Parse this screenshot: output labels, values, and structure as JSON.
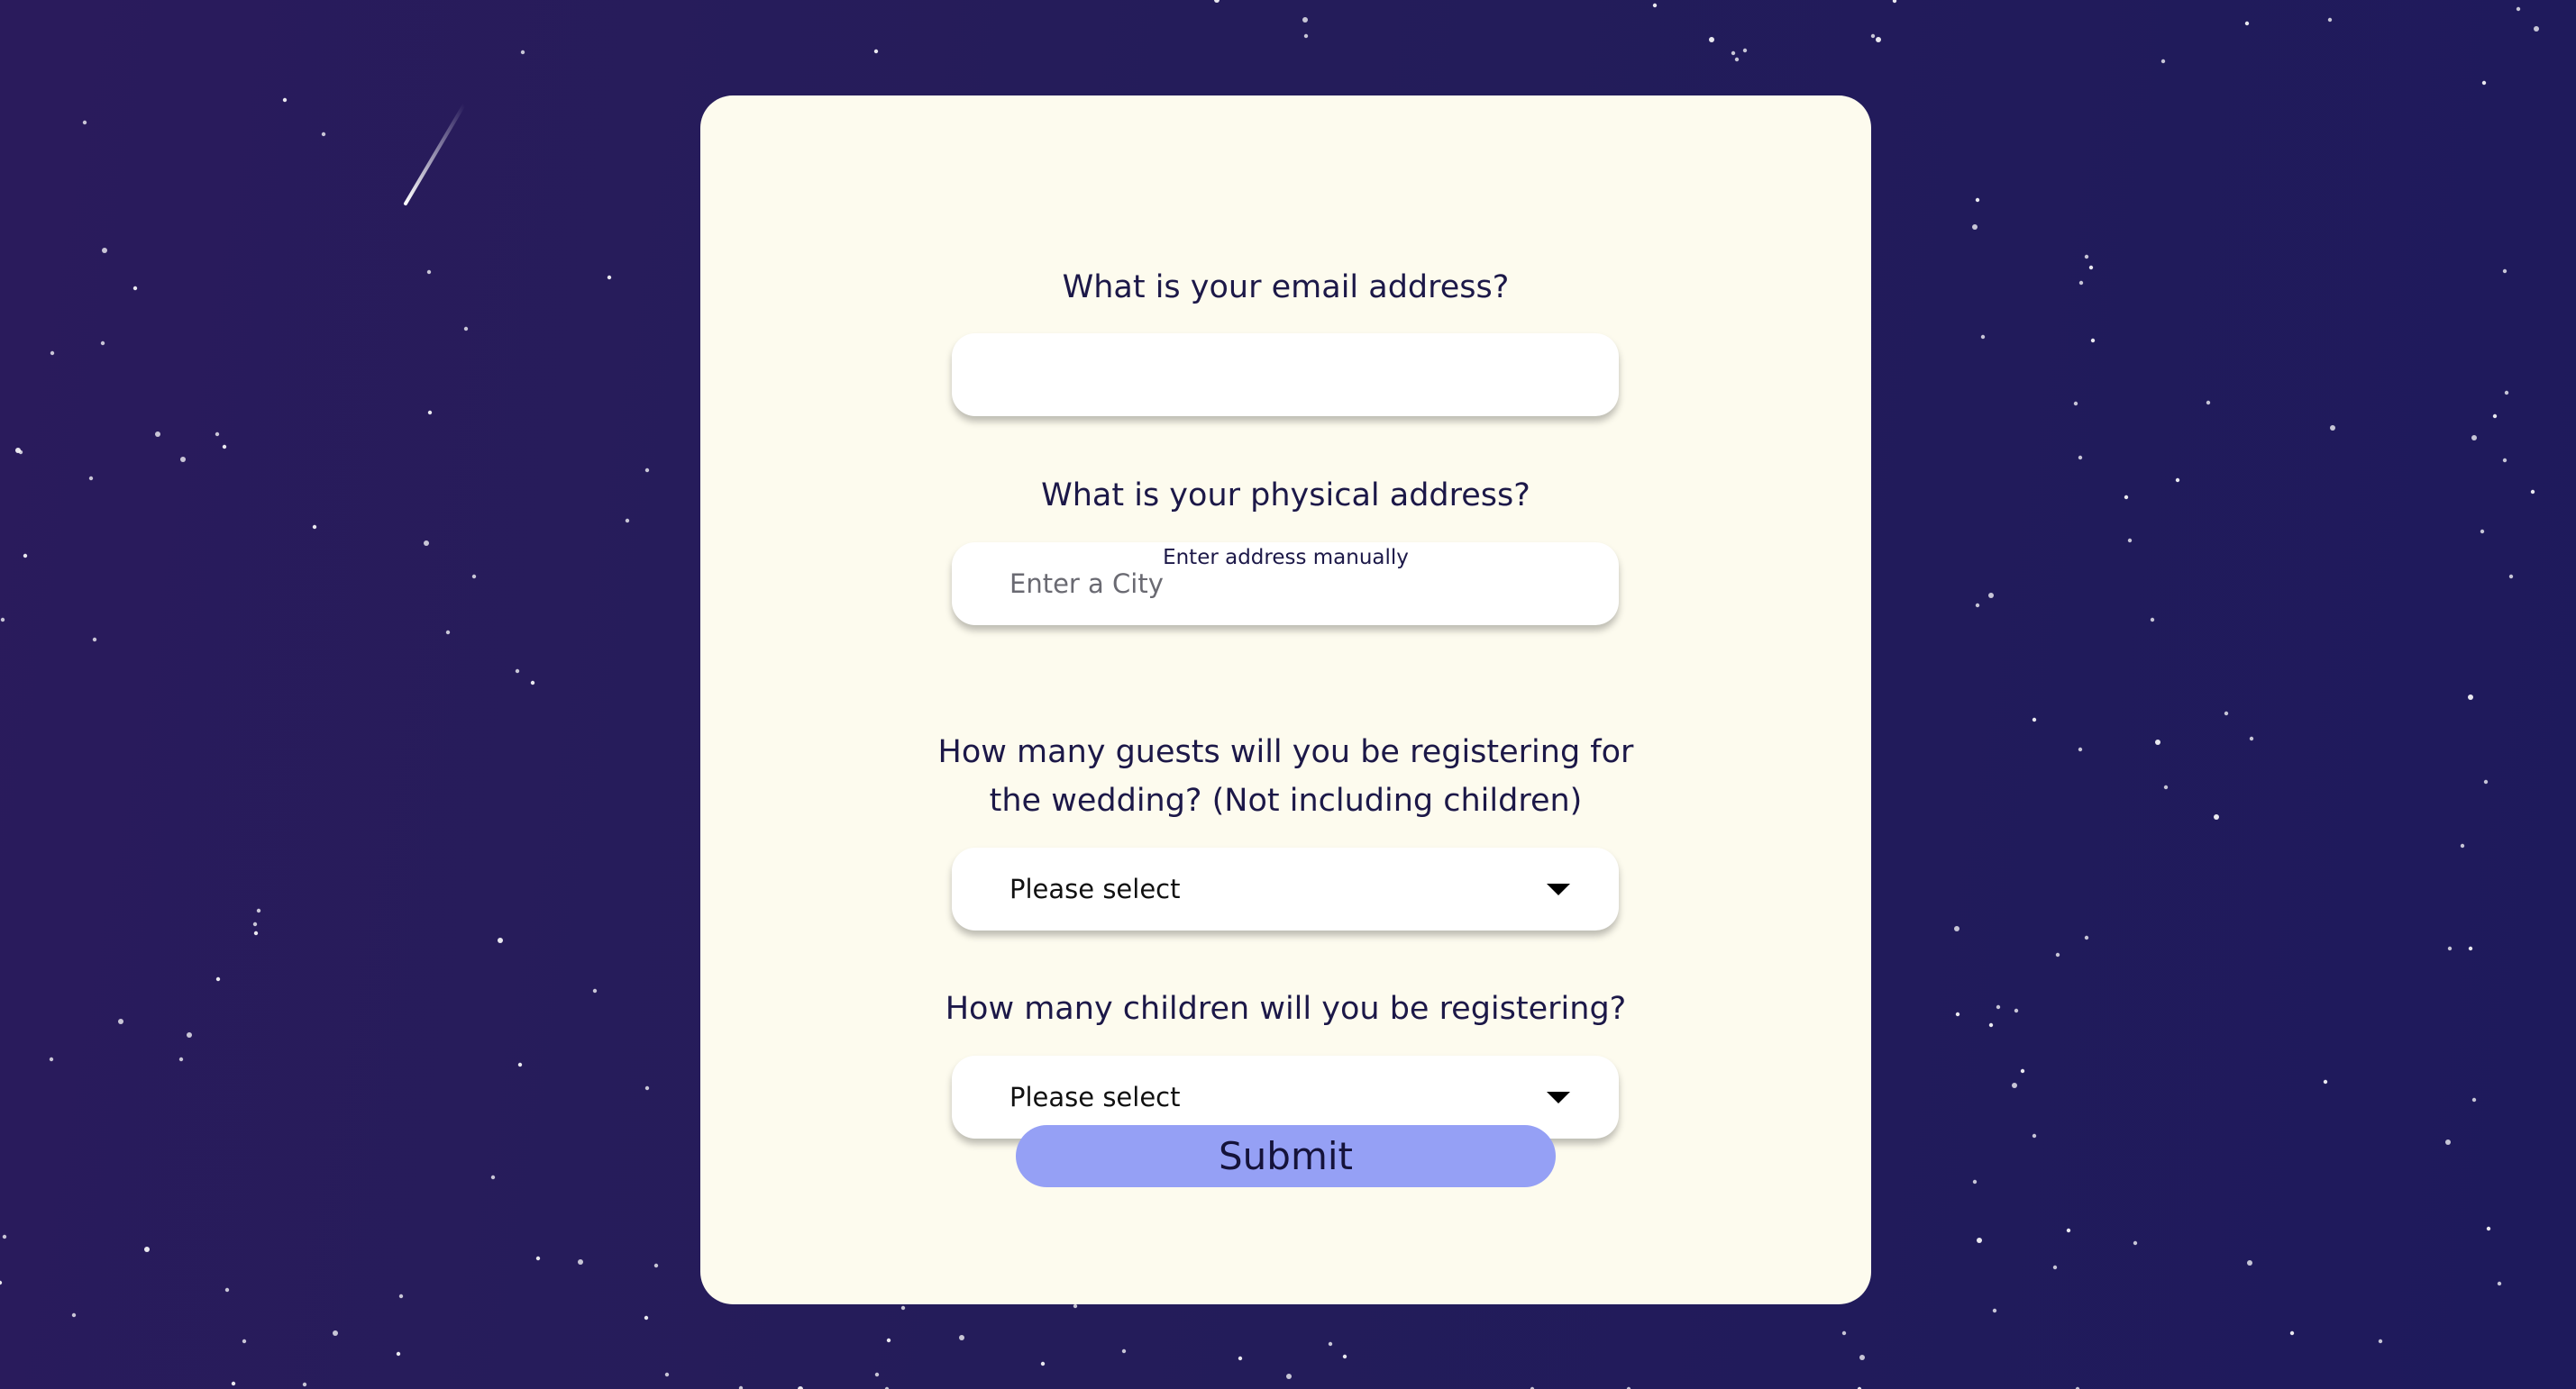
{
  "form": {
    "email": {
      "question": "What is your email address?",
      "value": "",
      "placeholder": ""
    },
    "address": {
      "question": "What is your physical address?",
      "value": "",
      "placeholder": "Enter a City",
      "manual_link": "Enter address manually"
    },
    "guests": {
      "question_line1": "How many guests will you be registering for",
      "question_line2": "the wedding? (Not including children)",
      "selected": "Please select"
    },
    "children": {
      "question": "How many children will you be registering?",
      "selected": "Please select"
    },
    "submit_label": "Submit"
  },
  "colors": {
    "background": "#251c5b",
    "card": "#fdfbee",
    "text": "#1c1848",
    "submit": "#95a0f5"
  }
}
